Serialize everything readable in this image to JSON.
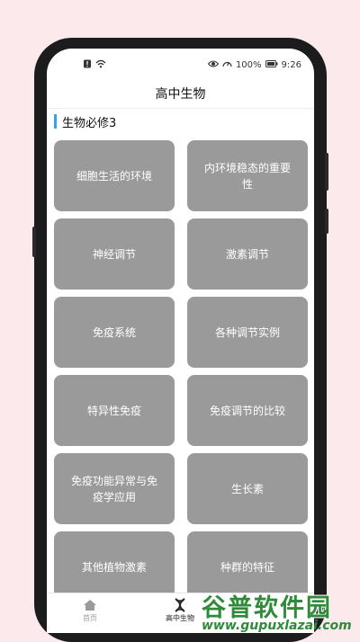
{
  "status": {
    "battery": "100%",
    "time": "9:26"
  },
  "appbar": {
    "title": "高中生物"
  },
  "section": {
    "title": "生物必修3"
  },
  "cards": [
    "细胞生活的环境",
    "内环境稳态的重要性",
    "神经调节",
    "激素调节",
    "免疫系统",
    "各种调节实例",
    "特异性免疫",
    "免疫调节的比较",
    "免疫功能异常与免疫学应用",
    "生长素",
    "其他植物激素",
    "种群的特征"
  ],
  "nav": {
    "home_label": "首页",
    "bio_label": "高中生物"
  },
  "watermark": {
    "brand": "谷普软件园",
    "url": "www.gupuxlazai.com"
  },
  "colors": {
    "accent": "#3aa0e8",
    "card": "#9a9a9a",
    "watermark": "#2f8a3a"
  }
}
